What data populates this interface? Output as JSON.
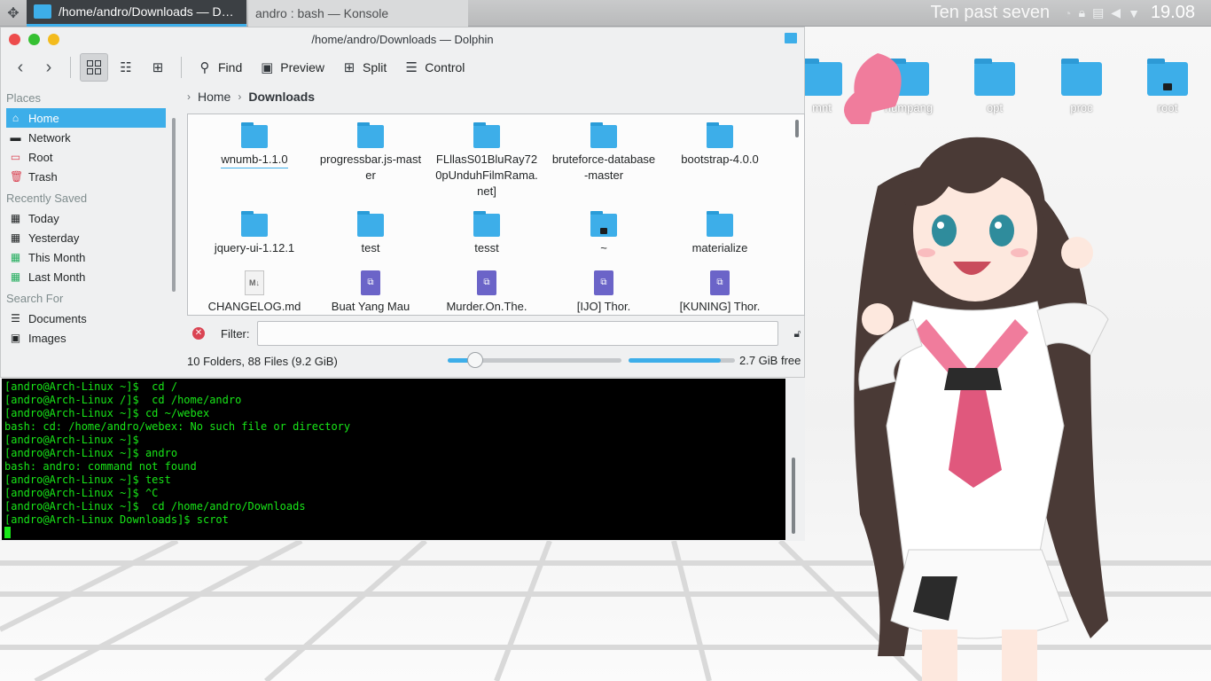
{
  "panel": {
    "tasks": [
      {
        "label": "/home/andro/Downloads — Dolp...",
        "icon": "folder-icon",
        "active": true
      },
      {
        "label": "andro : bash — Konsole",
        "icon": "konsole-icon",
        "active": false
      }
    ],
    "fuzzy_clock": "Ten past seven",
    "time": "19.08",
    "tray_icons": [
      "wifi-icon",
      "lock-icon",
      "clipboard-icon",
      "volume-icon",
      "expand-arrow-icon"
    ]
  },
  "desktop": {
    "icons": [
      {
        "label": "mnt",
        "locked": false
      },
      {
        "label": "numpang",
        "locked": false
      },
      {
        "label": "opt",
        "locked": false
      },
      {
        "label": "proc",
        "locked": false
      },
      {
        "label": "root",
        "locked": true
      }
    ]
  },
  "dolphin": {
    "title": "/home/andro/Downloads — Dolphin",
    "toolbar": {
      "find": "Find",
      "preview": "Preview",
      "split": "Split",
      "control": "Control"
    },
    "places": {
      "heading_places": "Places",
      "items": [
        {
          "label": "Home",
          "icon": "home-icon",
          "selected": true
        },
        {
          "label": "Network",
          "icon": "network-icon",
          "selected": false
        },
        {
          "label": "Root",
          "icon": "root-folder-icon",
          "selected": false
        },
        {
          "label": "Trash",
          "icon": "trash-icon",
          "selected": false
        }
      ],
      "heading_recent": "Recently Saved",
      "recent": [
        {
          "label": "Today",
          "icon": "calendar-icon"
        },
        {
          "label": "Yesterday",
          "icon": "calendar-icon"
        },
        {
          "label": "This Month",
          "icon": "calendar-icon"
        },
        {
          "label": "Last Month",
          "icon": "calendar-icon"
        }
      ],
      "heading_search": "Search For",
      "search": [
        {
          "label": "Documents",
          "icon": "documents-icon"
        },
        {
          "label": "Images",
          "icon": "images-icon"
        }
      ]
    },
    "breadcrumb": {
      "home": "Home",
      "current": "Downloads"
    },
    "files": [
      {
        "name": "wnumb-1.1.0",
        "kind": "folder"
      },
      {
        "name": "progressbar.js-master",
        "kind": "folder"
      },
      {
        "name": "FLllasS01BluRay720pUnduhFilmRama.net]",
        "kind": "folder"
      },
      {
        "name": "bruteforce-database-master",
        "kind": "folder"
      },
      {
        "name": "bootstrap-4.0.0",
        "kind": "folder"
      },
      {
        "name": "jquery-ui-1.12.1",
        "kind": "folder"
      },
      {
        "name": "test",
        "kind": "folder"
      },
      {
        "name": "tesst",
        "kind": "folder"
      },
      {
        "name": "~",
        "kind": "locked-folder"
      },
      {
        "name": "materialize",
        "kind": "folder"
      },
      {
        "name": "CHANGELOG.md",
        "kind": "markdown"
      },
      {
        "name": "Buat Yang Mau",
        "kind": "video"
      },
      {
        "name": "Murder.On.The.",
        "kind": "video"
      },
      {
        "name": "[IJO] Thor.",
        "kind": "video"
      },
      {
        "name": "[KUNING] Thor.",
        "kind": "video"
      }
    ],
    "filter": {
      "label": "Filter:",
      "value": "",
      "placeholder": ""
    },
    "status": {
      "summary": "10 Folders, 88 Files (9.2 GiB)",
      "free": "2.7 GiB free",
      "zoom_fraction": 0.16,
      "disk_used_fraction": 0.87
    }
  },
  "konsole": {
    "lines": [
      "[andro@Arch-Linux ~]$  cd /",
      "[andro@Arch-Linux /]$  cd /home/andro",
      "[andro@Arch-Linux ~]$ cd ~/webex",
      "bash: cd: /home/andro/webex: No such file or directory",
      "[andro@Arch-Linux ~]$",
      "[andro@Arch-Linux ~]$ andro",
      "bash: andro: command not found",
      "[andro@Arch-Linux ~]$ test",
      "[andro@Arch-Linux ~]$ ^C",
      "[andro@Arch-Linux ~]$  cd /home/andro/Downloads",
      "[andro@Arch-Linux Downloads]$ scrot"
    ]
  },
  "colors": {
    "accent": "#3daee9",
    "terminal_text": "#18e618",
    "close": "#ed4c4c",
    "maximize": "#35c032",
    "minimize": "#f3bb1d"
  }
}
